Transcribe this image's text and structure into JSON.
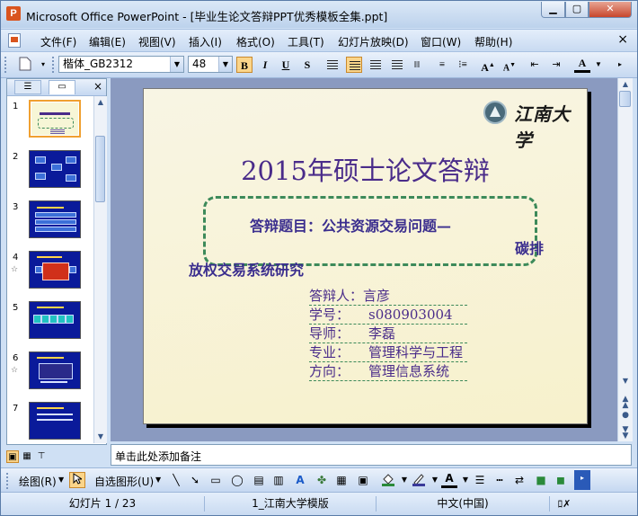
{
  "window": {
    "title": "Microsoft Office PowerPoint - [毕业生论文答辩PPT优秀模板全集.ppt]",
    "min_label": "▁",
    "max_label": "▢",
    "close_label": "✕"
  },
  "menu": {
    "items": [
      "文件(F)",
      "编辑(E)",
      "视图(V)",
      "插入(I)",
      "格式(O)",
      "工具(T)",
      "幻灯片放映(D)",
      "窗口(W)",
      "帮助(H)"
    ],
    "close": "×"
  },
  "format_toolbar": {
    "font": "楷体_GB2312",
    "size": "48",
    "bold": "B",
    "italic": "I",
    "underline": "U",
    "shadow": "S",
    "font_color_icon": "A"
  },
  "left_panel": {
    "slide_numbers": [
      "1",
      "2",
      "3",
      "4",
      "5",
      "6",
      "7"
    ],
    "star": "☆",
    "close": "×"
  },
  "slide": {
    "logo_text": "江南大学",
    "title": "2015年硕士论文答辩",
    "topic_line1": "答辩题目：公共资源交易问题—",
    "topic_line2": "碳排",
    "topic_line3": "放权交易系统研究",
    "info": [
      {
        "label": "答辩人：",
        "value": "言彦"
      },
      {
        "label": "学号：",
        "value": "s080903004"
      },
      {
        "label": "导师：",
        "value": "李磊"
      },
      {
        "label": "专业：",
        "value": "管理科学与工程"
      },
      {
        "label": "方向：",
        "value": "管理信息系统"
      }
    ]
  },
  "notes": {
    "placeholder": "单击此处添加备注"
  },
  "draw_toolbar": {
    "draw": "绘图(R)",
    "autoshape": "自选图形(U)"
  },
  "status": {
    "slide": "幻灯片 1 / 23",
    "template": "1_江南大学模版",
    "language": "中文(中国)"
  }
}
